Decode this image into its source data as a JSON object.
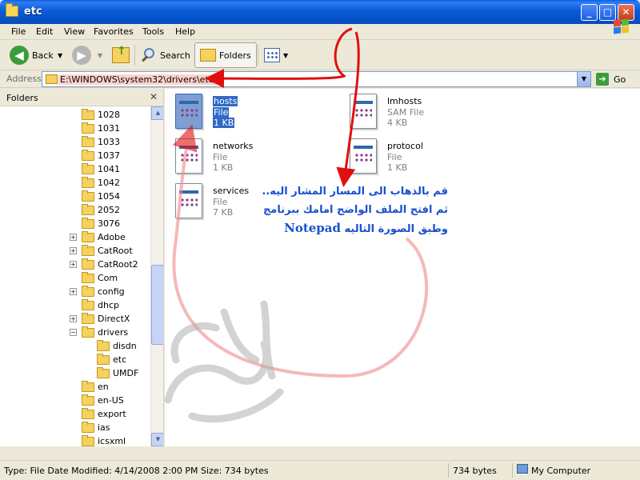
{
  "window": {
    "title": "etc"
  },
  "menu": [
    "File",
    "Edit",
    "View",
    "Favorites",
    "Tools",
    "Help"
  ],
  "toolbar": {
    "back": "Back",
    "search": "Search",
    "folders": "Folders"
  },
  "address": {
    "label": "Address",
    "path": "E:\\WINDOWS\\system32\\drivers\\etc",
    "go": "Go"
  },
  "folders_pane": {
    "title": "Folders",
    "items": [
      {
        "label": "1028"
      },
      {
        "label": "1031"
      },
      {
        "label": "1033"
      },
      {
        "label": "1037"
      },
      {
        "label": "1041"
      },
      {
        "label": "1042"
      },
      {
        "label": "1054"
      },
      {
        "label": "2052"
      },
      {
        "label": "3076"
      },
      {
        "label": "Adobe"
      },
      {
        "label": "CatRoot"
      },
      {
        "label": "CatRoot2"
      },
      {
        "label": "Com"
      },
      {
        "label": "config"
      },
      {
        "label": "dhcp"
      },
      {
        "label": "DirectX"
      },
      {
        "label": "drivers"
      },
      {
        "label": "disdn"
      },
      {
        "label": "etc"
      },
      {
        "label": "UMDF"
      },
      {
        "label": "en"
      },
      {
        "label": "en-US"
      },
      {
        "label": "export"
      },
      {
        "label": "ias"
      },
      {
        "label": "icsxml"
      }
    ]
  },
  "files": [
    {
      "name": "hosts",
      "type": "File",
      "size": "1 KB"
    },
    {
      "name": "lmhosts",
      "type": "SAM File",
      "size": "4 KB"
    },
    {
      "name": "networks",
      "type": "File",
      "size": "1 KB"
    },
    {
      "name": "protocol",
      "type": "File",
      "size": "1 KB"
    },
    {
      "name": "services",
      "type": "File",
      "size": "7 KB"
    }
  ],
  "annotation": {
    "line1": "قم بالذهاب الى المسار المشار اليه..",
    "line2": "ثم افتح الملف الواضح امامك ببرنامج",
    "line3_word": "Notepad",
    "line3_rest": "وطبق الصورة التاليه"
  },
  "status": {
    "info": "Type: File Date Modified: 4/14/2008 2:00 PM Size: 734 bytes",
    "size": "734 bytes",
    "location": "My Computer"
  }
}
